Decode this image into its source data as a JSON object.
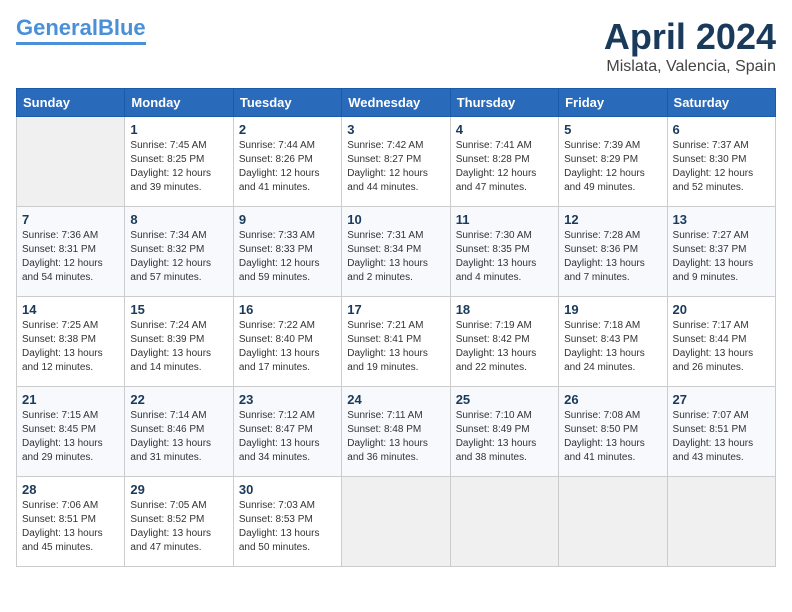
{
  "header": {
    "logo_line1": "General",
    "logo_line2": "Blue",
    "title": "April 2024",
    "subtitle": "Mislata, Valencia, Spain"
  },
  "weekdays": [
    "Sunday",
    "Monday",
    "Tuesday",
    "Wednesday",
    "Thursday",
    "Friday",
    "Saturday"
  ],
  "weeks": [
    [
      {
        "day": "",
        "info": ""
      },
      {
        "day": "1",
        "info": "Sunrise: 7:45 AM\nSunset: 8:25 PM\nDaylight: 12 hours\nand 39 minutes."
      },
      {
        "day": "2",
        "info": "Sunrise: 7:44 AM\nSunset: 8:26 PM\nDaylight: 12 hours\nand 41 minutes."
      },
      {
        "day": "3",
        "info": "Sunrise: 7:42 AM\nSunset: 8:27 PM\nDaylight: 12 hours\nand 44 minutes."
      },
      {
        "day": "4",
        "info": "Sunrise: 7:41 AM\nSunset: 8:28 PM\nDaylight: 12 hours\nand 47 minutes."
      },
      {
        "day": "5",
        "info": "Sunrise: 7:39 AM\nSunset: 8:29 PM\nDaylight: 12 hours\nand 49 minutes."
      },
      {
        "day": "6",
        "info": "Sunrise: 7:37 AM\nSunset: 8:30 PM\nDaylight: 12 hours\nand 52 minutes."
      }
    ],
    [
      {
        "day": "7",
        "info": "Sunrise: 7:36 AM\nSunset: 8:31 PM\nDaylight: 12 hours\nand 54 minutes."
      },
      {
        "day": "8",
        "info": "Sunrise: 7:34 AM\nSunset: 8:32 PM\nDaylight: 12 hours\nand 57 minutes."
      },
      {
        "day": "9",
        "info": "Sunrise: 7:33 AM\nSunset: 8:33 PM\nDaylight: 12 hours\nand 59 minutes."
      },
      {
        "day": "10",
        "info": "Sunrise: 7:31 AM\nSunset: 8:34 PM\nDaylight: 13 hours\nand 2 minutes."
      },
      {
        "day": "11",
        "info": "Sunrise: 7:30 AM\nSunset: 8:35 PM\nDaylight: 13 hours\nand 4 minutes."
      },
      {
        "day": "12",
        "info": "Sunrise: 7:28 AM\nSunset: 8:36 PM\nDaylight: 13 hours\nand 7 minutes."
      },
      {
        "day": "13",
        "info": "Sunrise: 7:27 AM\nSunset: 8:37 PM\nDaylight: 13 hours\nand 9 minutes."
      }
    ],
    [
      {
        "day": "14",
        "info": "Sunrise: 7:25 AM\nSunset: 8:38 PM\nDaylight: 13 hours\nand 12 minutes."
      },
      {
        "day": "15",
        "info": "Sunrise: 7:24 AM\nSunset: 8:39 PM\nDaylight: 13 hours\nand 14 minutes."
      },
      {
        "day": "16",
        "info": "Sunrise: 7:22 AM\nSunset: 8:40 PM\nDaylight: 13 hours\nand 17 minutes."
      },
      {
        "day": "17",
        "info": "Sunrise: 7:21 AM\nSunset: 8:41 PM\nDaylight: 13 hours\nand 19 minutes."
      },
      {
        "day": "18",
        "info": "Sunrise: 7:19 AM\nSunset: 8:42 PM\nDaylight: 13 hours\nand 22 minutes."
      },
      {
        "day": "19",
        "info": "Sunrise: 7:18 AM\nSunset: 8:43 PM\nDaylight: 13 hours\nand 24 minutes."
      },
      {
        "day": "20",
        "info": "Sunrise: 7:17 AM\nSunset: 8:44 PM\nDaylight: 13 hours\nand 26 minutes."
      }
    ],
    [
      {
        "day": "21",
        "info": "Sunrise: 7:15 AM\nSunset: 8:45 PM\nDaylight: 13 hours\nand 29 minutes."
      },
      {
        "day": "22",
        "info": "Sunrise: 7:14 AM\nSunset: 8:46 PM\nDaylight: 13 hours\nand 31 minutes."
      },
      {
        "day": "23",
        "info": "Sunrise: 7:12 AM\nSunset: 8:47 PM\nDaylight: 13 hours\nand 34 minutes."
      },
      {
        "day": "24",
        "info": "Sunrise: 7:11 AM\nSunset: 8:48 PM\nDaylight: 13 hours\nand 36 minutes."
      },
      {
        "day": "25",
        "info": "Sunrise: 7:10 AM\nSunset: 8:49 PM\nDaylight: 13 hours\nand 38 minutes."
      },
      {
        "day": "26",
        "info": "Sunrise: 7:08 AM\nSunset: 8:50 PM\nDaylight: 13 hours\nand 41 minutes."
      },
      {
        "day": "27",
        "info": "Sunrise: 7:07 AM\nSunset: 8:51 PM\nDaylight: 13 hours\nand 43 minutes."
      }
    ],
    [
      {
        "day": "28",
        "info": "Sunrise: 7:06 AM\nSunset: 8:51 PM\nDaylight: 13 hours\nand 45 minutes."
      },
      {
        "day": "29",
        "info": "Sunrise: 7:05 AM\nSunset: 8:52 PM\nDaylight: 13 hours\nand 47 minutes."
      },
      {
        "day": "30",
        "info": "Sunrise: 7:03 AM\nSunset: 8:53 PM\nDaylight: 13 hours\nand 50 minutes."
      },
      {
        "day": "",
        "info": ""
      },
      {
        "day": "",
        "info": ""
      },
      {
        "day": "",
        "info": ""
      },
      {
        "day": "",
        "info": ""
      }
    ]
  ]
}
